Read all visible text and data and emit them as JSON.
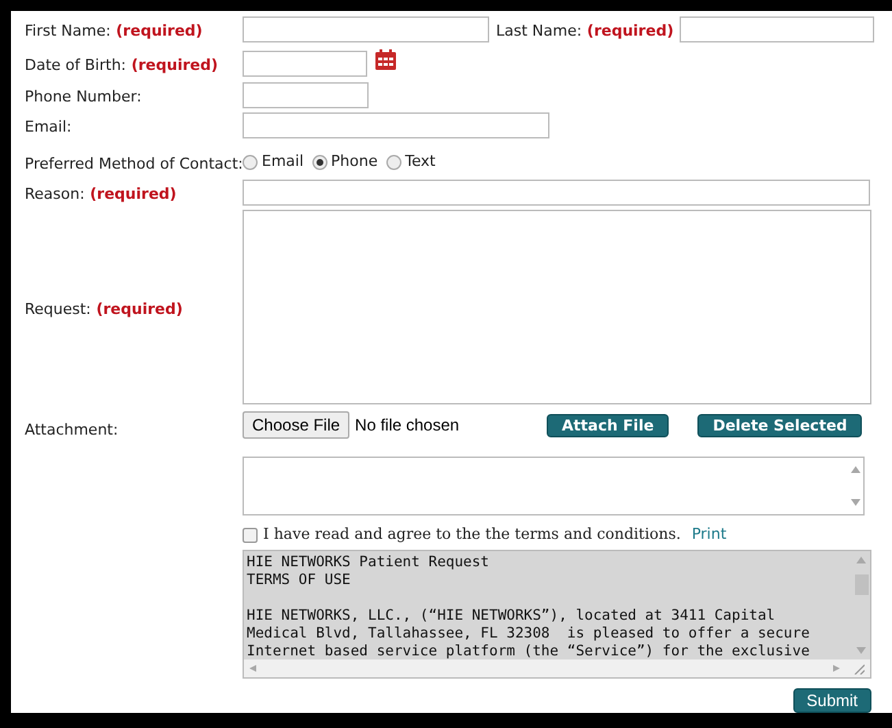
{
  "first_name": {
    "label": "First Name:",
    "note": "(required)"
  },
  "last_name": {
    "label": "Last Name:",
    "note": "(required)"
  },
  "date_of_birth": {
    "label": "Date of Birth:",
    "note": "(required)"
  },
  "phone": {
    "label": "Phone Number:"
  },
  "email": {
    "label": "Email:"
  },
  "contact": {
    "label": "Preferred Method of Contact:",
    "options": [
      {
        "label": "Email",
        "selected": false
      },
      {
        "label": "Phone",
        "selected": true
      },
      {
        "label": "Text",
        "selected": false
      }
    ]
  },
  "reason": {
    "label": "Reason:",
    "note": "(required)"
  },
  "request": {
    "label": "Request:",
    "note": "(required)"
  },
  "attachment": {
    "label": "Attachment:",
    "choose_button": "Choose File",
    "file_status": "No file chosen",
    "attach_button": "Attach File",
    "delete_button": "Delete Selected"
  },
  "agree": {
    "checked": false,
    "text": "I have read and agree to the the terms and conditions.",
    "link": "Print"
  },
  "terms": {
    "paragraphs": [
      [
        "HIE NETWORKS Patient Request",
        "TERMS OF USE"
      ],
      [
        "HIE NETWORKS, LLC., (“HIE NETWORKS”), located at 3411 Capital",
        "Medical Blvd, Tallahassee, FL 32308  is pleased to offer a secure",
        "Internet based service platform (the “Service”) for the exclusive"
      ]
    ]
  },
  "submit": "Submit"
}
